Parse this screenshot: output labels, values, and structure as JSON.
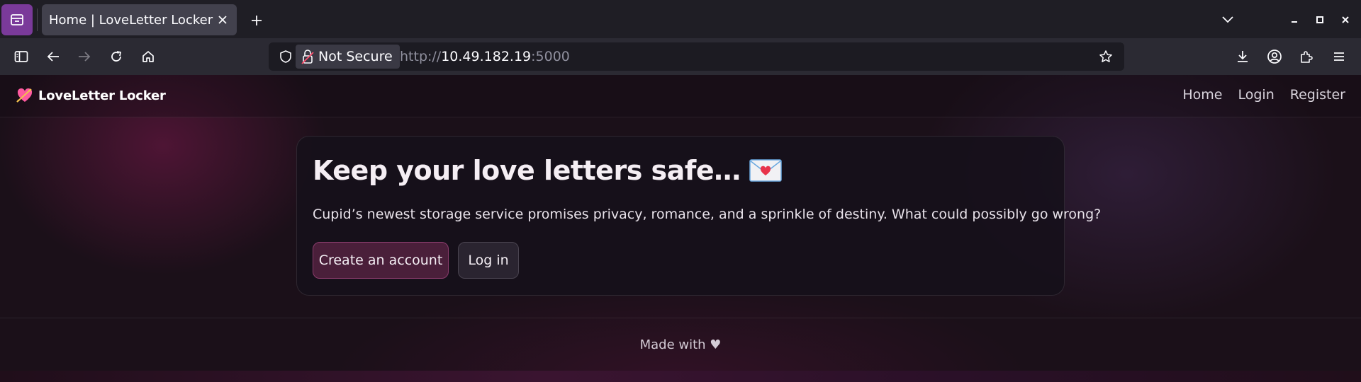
{
  "browser": {
    "tab_title": "Home | LoveLetter Locker",
    "security_label": "Not Secure",
    "url_scheme": "http://",
    "url_host": "10.49.182.19",
    "url_port": ":5000"
  },
  "site": {
    "brand": "LoveLetter Locker",
    "nav": [
      "Home",
      "Login",
      "Register"
    ]
  },
  "hero": {
    "title": "Keep your love letters safe…",
    "description": "Cupid’s newest storage service promises privacy, romance, and a sprinkle of destiny. What could possibly go wrong?",
    "primary_button": "Create an account",
    "secondary_button": "Log in"
  },
  "footer": {
    "text": "Made with ♥"
  }
}
